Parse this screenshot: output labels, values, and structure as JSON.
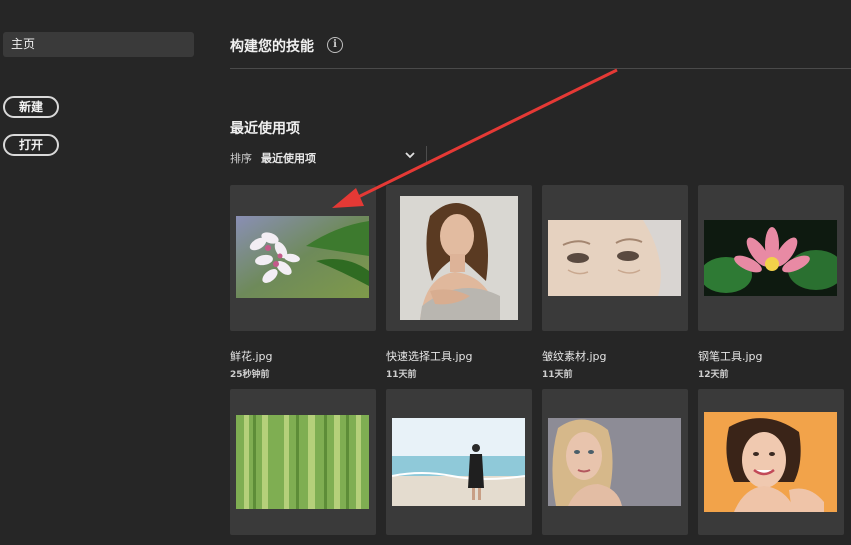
{
  "sidebar": {
    "home_label": "主页",
    "new_label": "新建",
    "open_label": "打开"
  },
  "main": {
    "build_title": "构建您的技能",
    "info_glyph": "i",
    "recent_title": "最近使用项",
    "sort_label": "排序",
    "sort_value": "最近使用项"
  },
  "files": [
    {
      "name": "鲜花.jpg",
      "time": "25秒钟前",
      "thumb": "flower-thumbnail"
    },
    {
      "name": "快速选择工具.jpg",
      "time": "11天前",
      "thumb": "portrait-woman-thumbnail"
    },
    {
      "name": "皱纹素材.jpg",
      "time": "11天前",
      "thumb": "elderly-face-thumbnail"
    },
    {
      "name": "钢笔工具.jpg",
      "time": "12天前",
      "thumb": "lotus-thumbnail"
    },
    {
      "thumb": "forest-thumbnail"
    },
    {
      "thumb": "beach-thumbnail"
    },
    {
      "thumb": "woman-face-thumbnail"
    },
    {
      "thumb": "smiling-woman-thumbnail"
    }
  ],
  "colors": {
    "background": "#262626",
    "card": "#3a3a3a",
    "annotation_arrow": "#e53935"
  }
}
